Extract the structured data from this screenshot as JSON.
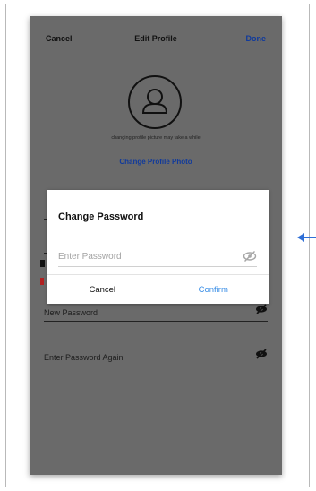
{
  "navbar": {
    "cancel": "Cancel",
    "title": "Edit Profile",
    "done": "Done"
  },
  "profile": {
    "avatar_icon": "user-icon",
    "hint": "changing profile picture may take a while",
    "change_photo": "Change Profile Photo"
  },
  "form": {
    "new_password_label": "New Password",
    "again_label": "Enter Password Again",
    "eye_icon": "eye-off-icon"
  },
  "dialog": {
    "title": "Change Password",
    "placeholder": "Enter Password",
    "cancel": "Cancel",
    "confirm": "Confirm"
  },
  "colors": {
    "overlay": "#6a6a6a",
    "link_blue": "#103a9c",
    "confirm_blue": "#3a8ee6",
    "arrow_blue": "#2f6fd6"
  },
  "annotation": {
    "arrow_icon": "arrow-left-icon"
  }
}
